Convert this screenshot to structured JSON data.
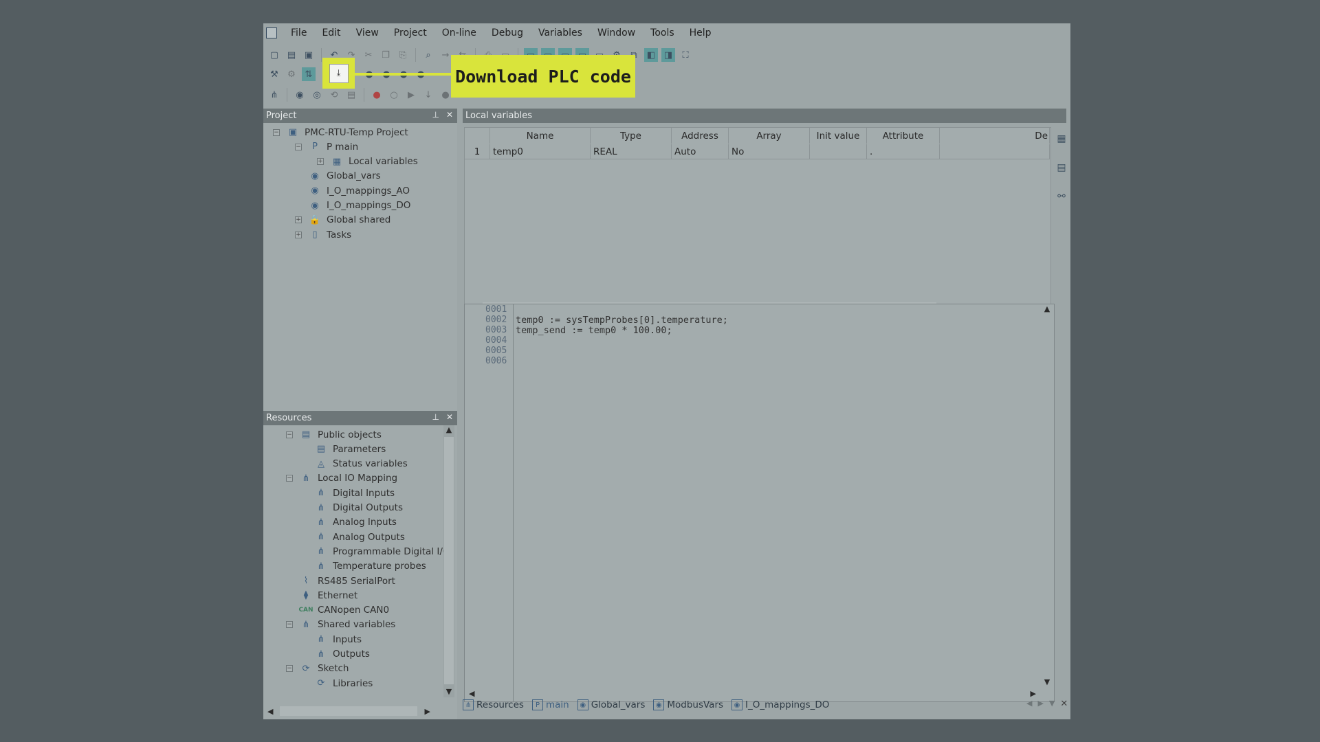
{
  "menu": [
    "File",
    "Edit",
    "View",
    "Project",
    "On-line",
    "Debug",
    "Variables",
    "Window",
    "Tools",
    "Help"
  ],
  "callout": {
    "label": "Download PLC code"
  },
  "project_panel": {
    "title": "Project",
    "tree": [
      {
        "label": "PMC-RTU-Temp Project",
        "indent": 0,
        "exp": "−",
        "icon": "project-icon"
      },
      {
        "label": "P main",
        "indent": 1,
        "exp": "−",
        "icon": "program-icon"
      },
      {
        "label": "Local variables",
        "indent": 2,
        "exp": "+",
        "icon": "grid-icon"
      },
      {
        "label": "Global_vars",
        "indent": 1,
        "exp": "",
        "icon": "global-vars-icon"
      },
      {
        "label": "I_O_mappings_AO",
        "indent": 1,
        "exp": "",
        "icon": "global-vars-icon"
      },
      {
        "label": "I_O_mappings_DO",
        "indent": 1,
        "exp": "",
        "icon": "global-vars-icon"
      },
      {
        "label": "Global shared",
        "indent": 1,
        "exp": "+",
        "icon": "lock-icon"
      },
      {
        "label": "Tasks",
        "indent": 1,
        "exp": "+",
        "icon": "clipboard-icon"
      }
    ]
  },
  "resources_panel": {
    "title": "Resources",
    "tree": [
      {
        "label": "Public objects",
        "indent": 0,
        "exp": "−",
        "icon": "objects-icon"
      },
      {
        "label": "Parameters",
        "indent": 1,
        "exp": "",
        "icon": "table-icon"
      },
      {
        "label": "Status variables",
        "indent": 1,
        "exp": "",
        "icon": "status-icon"
      },
      {
        "label": "Local IO Mapping",
        "indent": 0,
        "exp": "−",
        "icon": "mapping-icon"
      },
      {
        "label": "Digital Inputs",
        "indent": 1,
        "exp": "",
        "icon": "mapping-icon"
      },
      {
        "label": "Digital Outputs",
        "indent": 1,
        "exp": "",
        "icon": "mapping-icon"
      },
      {
        "label": "Analog Inputs",
        "indent": 1,
        "exp": "",
        "icon": "mapping-icon"
      },
      {
        "label": "Analog Outputs",
        "indent": 1,
        "exp": "",
        "icon": "mapping-icon"
      },
      {
        "label": "Programmable Digital I/O",
        "indent": 1,
        "exp": "",
        "icon": "mapping-icon"
      },
      {
        "label": "Temperature probes",
        "indent": 1,
        "exp": "",
        "icon": "mapping-icon"
      },
      {
        "label": "RS485 SerialPort",
        "indent": 0,
        "exp": "",
        "icon": "serial-icon"
      },
      {
        "label": "Ethernet",
        "indent": 0,
        "exp": "",
        "icon": "ethernet-icon"
      },
      {
        "label": "CANopen CAN0",
        "indent": 0,
        "exp": "",
        "icon": "can-icon"
      },
      {
        "label": "Shared variables",
        "indent": 0,
        "exp": "−",
        "icon": "mapping-icon"
      },
      {
        "label": "Inputs",
        "indent": 1,
        "exp": "",
        "icon": "mapping-icon"
      },
      {
        "label": "Outputs",
        "indent": 1,
        "exp": "",
        "icon": "mapping-icon"
      },
      {
        "label": "Sketch",
        "indent": 0,
        "exp": "−",
        "icon": "sketch-icon"
      },
      {
        "label": "Libraries",
        "indent": 1,
        "exp": "",
        "icon": "sketch-icon"
      }
    ]
  },
  "local_vars": {
    "title": "Local variables",
    "columns": [
      "",
      "Name",
      "Type",
      "Address",
      "Array",
      "Init value",
      "Attribute",
      "De"
    ],
    "rows": [
      [
        "1",
        "temp0",
        "REAL",
        "Auto",
        "No",
        "",
        ".",
        ""
      ]
    ]
  },
  "code": {
    "lines": [
      {
        "num": "0001",
        "text": ""
      },
      {
        "num": "0002",
        "text": "temp0 := sysTempProbes[0].temperature;"
      },
      {
        "num": "0003",
        "text": "temp_send := temp0 * 100.00;"
      },
      {
        "num": "0004",
        "text": ""
      },
      {
        "num": "0005",
        "text": ""
      },
      {
        "num": "0006",
        "text": ""
      }
    ]
  },
  "bottom_tabs": [
    "Resources",
    "main",
    "Global_vars",
    "ModbusVars",
    "I_O_mappings_DO"
  ]
}
